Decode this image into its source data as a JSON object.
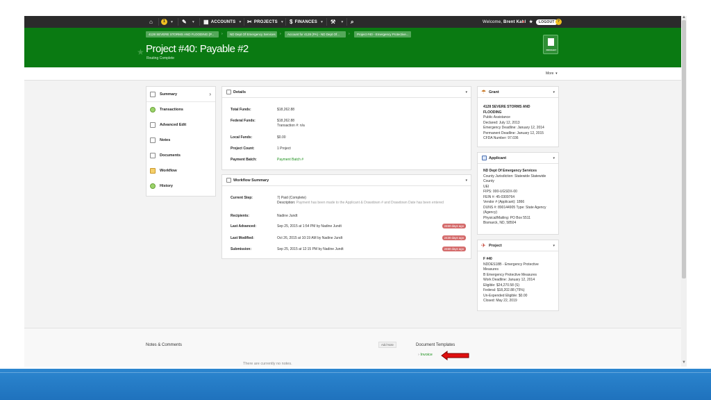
{
  "nav": {
    "accounts": "ACCOUNTS",
    "projects": "PROJECTS",
    "finances": "FINANCES",
    "badge_count": "1",
    "welcome": "Welcome,",
    "user_name": "Brent Kahl",
    "logout": "LOGOUT"
  },
  "breadcrumbs": [
    "4128 SEVERE STORMS AND FLOODING (P...",
    "ND Dept Of Emergency Services",
    "Account for 4128 (PA) - ND Dept Of...",
    "Project #40 - Emergency Protective..."
  ],
  "header": {
    "title": "Project #40: Payable #2",
    "subtitle": "Routing Complete",
    "doc_button_label": "ROUGHLY"
  },
  "more_label": "More",
  "menu": [
    {
      "label": "Summary"
    },
    {
      "label": "Transactions"
    },
    {
      "label": "Advanced Edit"
    },
    {
      "label": "Notes"
    },
    {
      "label": "Documents"
    },
    {
      "label": "Workflow"
    },
    {
      "label": "History"
    }
  ],
  "details": {
    "title": "Details",
    "total_funds_label": "Total Funds:",
    "total_funds": "$18,262.88",
    "federal_funds_label": "Federal Funds:",
    "federal_funds": "$18,262.88",
    "transaction": "Transaction #: n/a",
    "local_funds_label": "Local Funds:",
    "local_funds": "$0.00",
    "project_count_label": "Project Count:",
    "project_count": "1 Project",
    "payment_batch_label": "Payment Batch:",
    "payment_batch": "Payment Batch #"
  },
  "workflow": {
    "title": "Workflow Summary",
    "current_step_label": "Current Step:",
    "current_step": "7) Paid (Complete)",
    "description_label": "Description:",
    "description": "Payment has been made to the Applicant & Drawdown # and Drawdown Date has been entered",
    "recipients_label": "Recipients:",
    "recipients": "Nadine Jundt",
    "last_advanced_label": "Last Advanced:",
    "last_advanced": "Sep 25, 2015 at 1:54 PM by Nadine Jundt",
    "last_advanced_days": "2460 days ago",
    "last_modified_label": "Last Modified:",
    "last_modified": "Oct 26, 2015 at 10:19 AM by Nadine Jundt",
    "last_modified_days": "2430 days ago",
    "submission_label": "Submission:",
    "submission": "Sep 25, 2015 at 12:15 PM by Nadine Jundt",
    "submission_days": "2460 days ago"
  },
  "grant": {
    "title": "Grant",
    "name_line1": "4128 SEVERE STORMS AND",
    "name_line2": "FLOODING",
    "lines": [
      "Public Assistance",
      "Declared: July 12, 2013",
      "Emergency Deadline: January 12, 2014",
      "Permanent Deadline: January 12, 2015",
      "CFDA Number: 97.036"
    ]
  },
  "applicant": {
    "title": "Applicant",
    "name": "ND Dept Of Emergency Services",
    "lines": [
      "County Jurisdiction: Statewide Statewide",
      "County",
      "UEI",
      "FIPS: 000-UGSDX-00",
      "FEIN #: 45-0309764",
      "Vendor # (Applicant): 1866",
      "DUNS #: 890144905 Type: State Agency",
      "(Agency)",
      "Physical/Mailing: PO Box 5511",
      "Bismarck, ND, 58504"
    ]
  },
  "project": {
    "title": "Project",
    "name": "F #40",
    "lines": [
      "NDDES18B - Emergency Protective",
      "Measures",
      "B Emergency Protective Measures",
      "Work Deadline: January 12, 2014",
      "Eligible: $24,270.58 (S)",
      "Federal: $18,202.88 (75%)",
      "Un-Expended Eligible: $0.00",
      "Closed: May 22, 2019"
    ]
  },
  "bottom": {
    "notes_title": "Notes & Comments",
    "add_note": "Add Note",
    "no_notes": "There are currently no notes.",
    "doc_templates": "Document Templates",
    "invoice": "Invoice"
  },
  "colors": {
    "header_green": "#0a7a12",
    "nav_dark": "#2b2b2b",
    "days_badge": "#d46a6a",
    "link_green": "#1a8f1a",
    "arrow_red": "#e01010",
    "bottom_band_blue": "#2079c3"
  }
}
